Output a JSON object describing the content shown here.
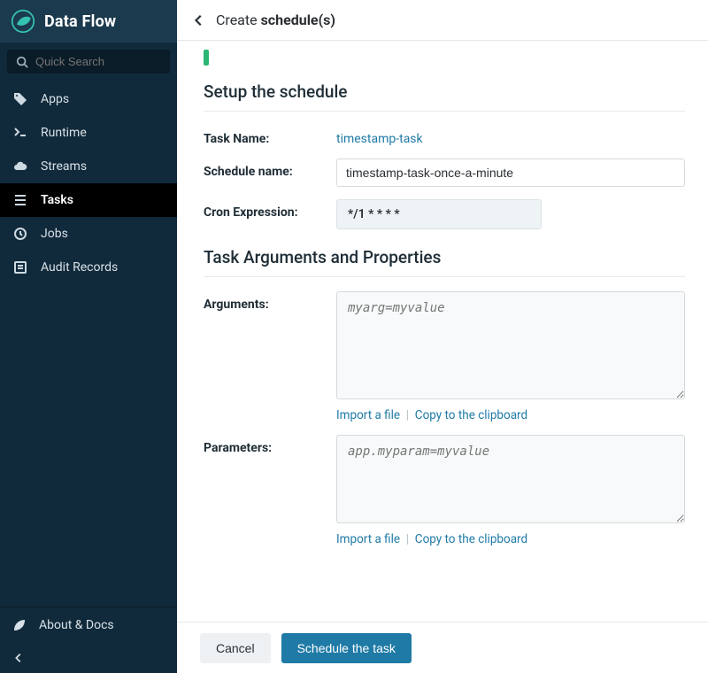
{
  "brand": "Data Flow",
  "search": {
    "placeholder": "Quick Search"
  },
  "nav": {
    "items": [
      {
        "label": "Apps"
      },
      {
        "label": "Runtime"
      },
      {
        "label": "Streams"
      },
      {
        "label": "Tasks"
      },
      {
        "label": "Jobs"
      },
      {
        "label": "Audit Records"
      }
    ],
    "activeIndex": 3,
    "footer": {
      "about": "About & Docs"
    }
  },
  "header": {
    "prefix": "Create ",
    "bold": "schedule(s)"
  },
  "sections": {
    "setup": "Setup the schedule",
    "args": "Task Arguments and Properties"
  },
  "form": {
    "taskNameLabel": "Task Name:",
    "taskNameValue": "timestamp-task",
    "scheduleNameLabel": "Schedule name:",
    "scheduleNameValue": "timestamp-task-once-a-minute",
    "cronLabel": "Cron Expression:",
    "cronValue": "*/1 * * * *",
    "argumentsLabel": "Arguments:",
    "argumentsPlaceholder": "myarg=myvalue",
    "parametersLabel": "Parameters:",
    "parametersPlaceholder": "app.myparam=myvalue",
    "importLink": "Import a file",
    "copyLink": "Copy to the clipboard"
  },
  "buttons": {
    "cancel": "Cancel",
    "submit": "Schedule the task"
  }
}
